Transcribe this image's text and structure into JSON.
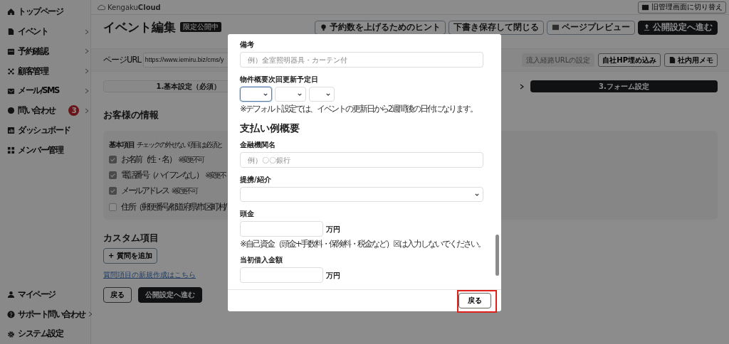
{
  "sidebar": {
    "top_items": [
      {
        "label": "トップページ",
        "has_submenu": false
      },
      {
        "label": "イベント",
        "has_submenu": true
      },
      {
        "label": "予約確認",
        "has_submenu": true
      },
      {
        "label": "顧客管理",
        "has_submenu": true
      },
      {
        "label": "メール/SMS",
        "has_submenu": true
      },
      {
        "label": "問い合わせ",
        "has_submenu": true,
        "badge": "3"
      },
      {
        "label": "ダッシュボード",
        "has_submenu": false
      },
      {
        "label": "メンバー管理",
        "has_submenu": false
      }
    ],
    "bottom_items": [
      {
        "label": "マイページ",
        "has_submenu": false
      },
      {
        "label": "サポート問い合わせ",
        "has_submenu": true
      },
      {
        "label": "システム設定",
        "has_submenu": false
      }
    ]
  },
  "header": {
    "logo_plain": "Kengaku",
    "logo_bold": "Cloud",
    "switch_button": "旧管理画面に切り替え"
  },
  "title": "イベント編集",
  "status_badge": "限定公開中",
  "header_buttons": [
    {
      "label": "予約数を上げるためのヒント",
      "kind": "outline"
    },
    {
      "label": "下書き保存して閉じる",
      "kind": "outline"
    },
    {
      "label": "ページプレビュー",
      "kind": "outline"
    },
    {
      "label": "公開設定へ進む",
      "kind": "dark"
    }
  ],
  "page_url": {
    "label": "ページURL",
    "value": "https://www.iemiru.biz/cms/y"
  },
  "url_buttons": [
    {
      "label": "流入経路URLの設定",
      "disabled": true
    },
    {
      "label": "自社HP埋め込み",
      "disabled": false
    },
    {
      "label": "社内用メモ",
      "disabled": false
    }
  ],
  "steps": [
    {
      "label": "1.基本設定（必須）",
      "selected": false
    },
    {
      "label": "3.フォーム設定",
      "selected": true
    }
  ],
  "customer_section": {
    "title": "お客様の情報",
    "basic_label": "基本項目",
    "basic_note": "チェックの外せない項目は必須と",
    "fields": [
      {
        "label": "お名前（性・名）",
        "note": "※変更不可",
        "checked": true
      },
      {
        "label": "電話番号（ハイフンなし）",
        "note": "※変更不",
        "checked": true
      },
      {
        "label": "メールアドレス",
        "note": "※変更不可",
        "checked": true
      },
      {
        "label": "住所（郵便番号/都道府県/市区町村/",
        "checked": false
      }
    ]
  },
  "custom_section": {
    "title": "カスタム項目",
    "add_button": "+ 質問を追加",
    "link": "質問項目の新規作成はこちら",
    "buttons": [
      {
        "label": "戻る",
        "kind": "outline"
      },
      {
        "label": "公開設定へ進む",
        "kind": "dark"
      }
    ]
  },
  "modal": {
    "fields": [
      {
        "kind": "text",
        "label": "備考",
        "placeholder": "例）全室照明器具・カーテン付"
      },
      {
        "kind": "date",
        "label": "物件概要次回更新予定日",
        "selects": [
          {
            "focused": true
          },
          {
            "focused": false
          },
          {
            "focused": false
          }
        ],
        "note": "※デフォルト設定では、イベントの更新日から2週間後の日付になります。"
      },
      {
        "kind": "heading",
        "label": "支払い例概要"
      },
      {
        "kind": "text",
        "label": "金融機関名",
        "placeholder": "例）〇〇銀行"
      },
      {
        "kind": "select",
        "label": "提携/紹介"
      },
      {
        "kind": "amount",
        "label": "頭金",
        "unit": "万円",
        "note": "※自己資金（頭金+手数料・保険料・税金など）☒は入力しないでください。"
      },
      {
        "kind": "amount",
        "label": "当初借入金額",
        "unit": "万円"
      }
    ],
    "footer_button": "戻る",
    "footer_highlighted": true
  }
}
